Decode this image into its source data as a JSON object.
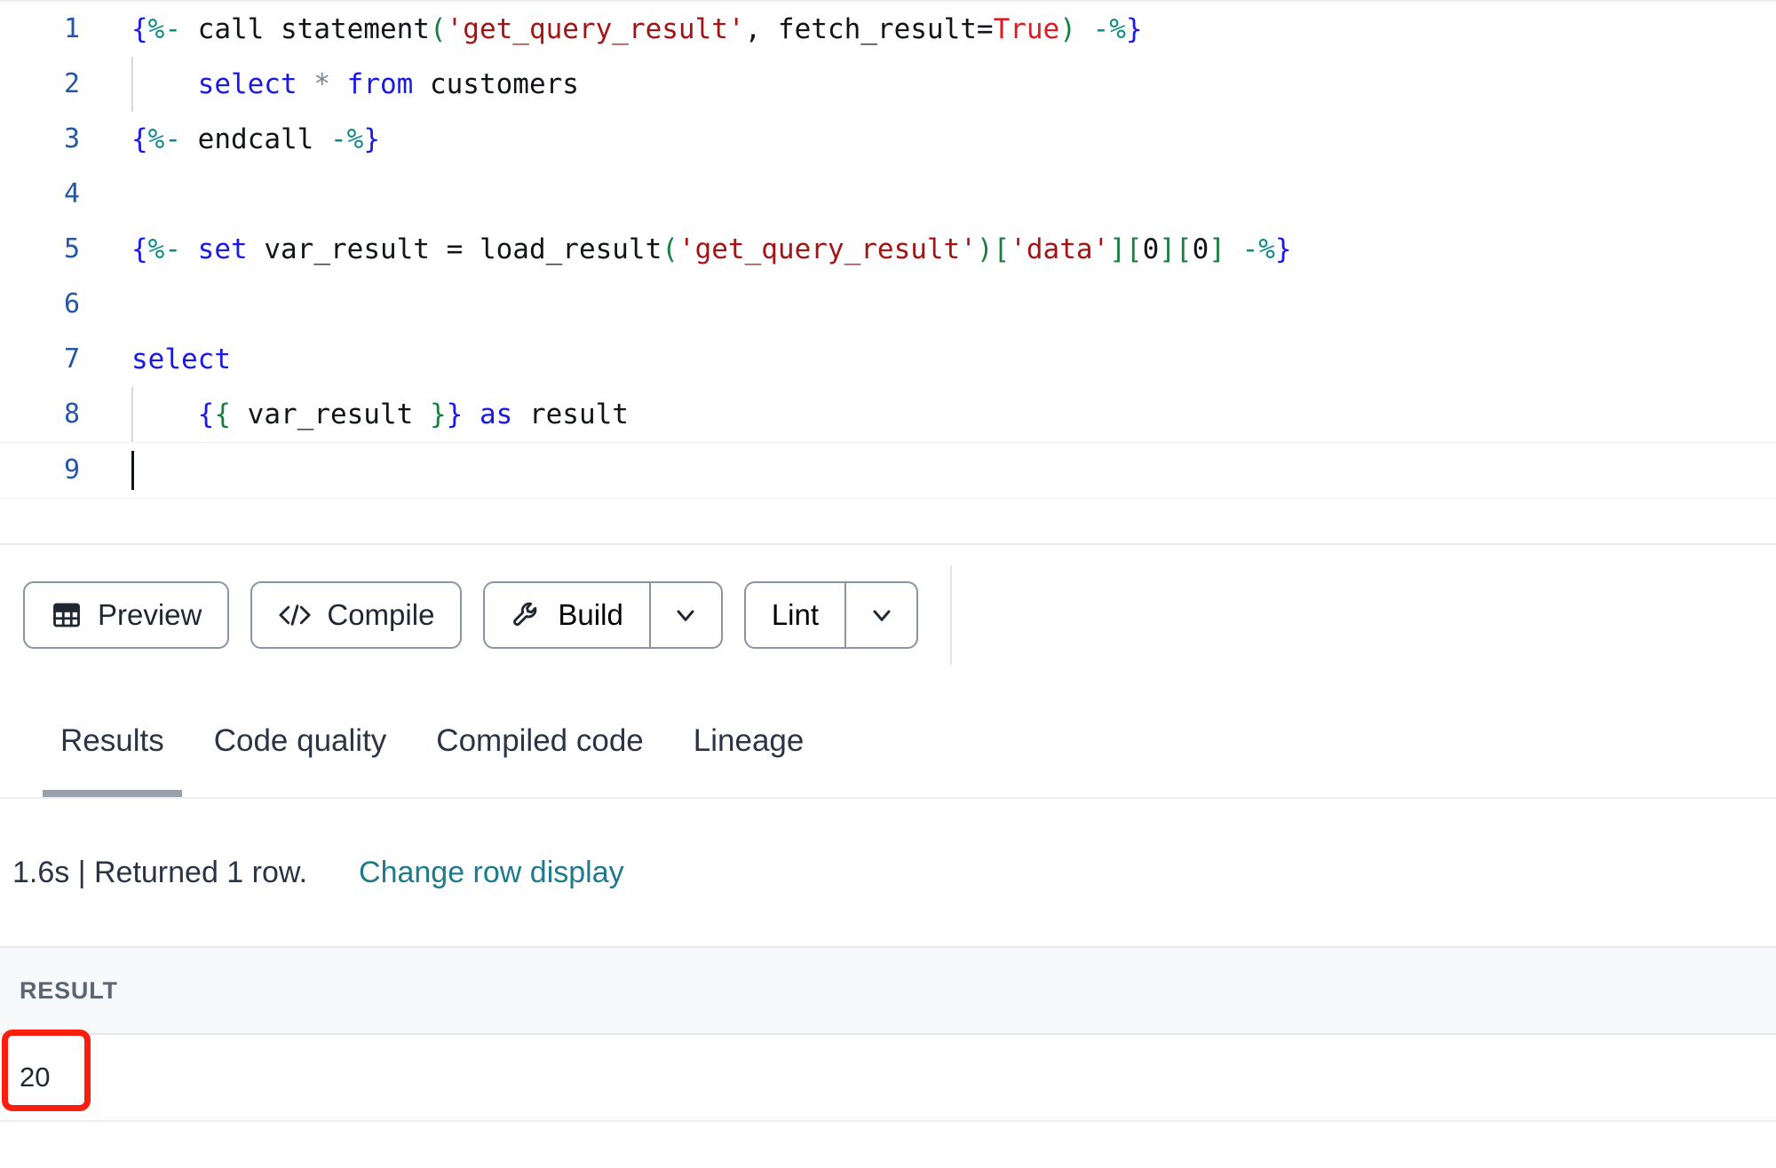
{
  "editor": {
    "lines": [
      {
        "number": "1",
        "indent_guide": false,
        "caret": false,
        "tokens": [
          {
            "text": "{",
            "cls": "t-brace"
          },
          {
            "text": "%- ",
            "cls": "t-pct"
          },
          {
            "text": "call",
            "cls": "t-plain"
          },
          {
            "text": " statement",
            "cls": "t-plain"
          },
          {
            "text": "(",
            "cls": "t-paren"
          },
          {
            "text": "'get_query_result'",
            "cls": "t-str"
          },
          {
            "text": ",",
            "cls": "t-plain"
          },
          {
            "text": " fetch_result=",
            "cls": "t-plain"
          },
          {
            "text": "True",
            "cls": "t-bool"
          },
          {
            "text": ")",
            "cls": "t-paren"
          },
          {
            "text": " -",
            "cls": "t-pct"
          },
          {
            "text": "%",
            "cls": "t-pct"
          },
          {
            "text": "}",
            "cls": "t-brace"
          }
        ]
      },
      {
        "number": "2",
        "indent_guide": true,
        "caret": false,
        "tokens": [
          {
            "text": "    ",
            "cls": "t-plain"
          },
          {
            "text": "select",
            "cls": "t-kw"
          },
          {
            "text": " ",
            "cls": "t-plain"
          },
          {
            "text": "*",
            "cls": "t-star"
          },
          {
            "text": " ",
            "cls": "t-plain"
          },
          {
            "text": "from",
            "cls": "t-kw"
          },
          {
            "text": " customers",
            "cls": "t-plain"
          }
        ]
      },
      {
        "number": "3",
        "indent_guide": false,
        "caret": false,
        "tokens": [
          {
            "text": "{",
            "cls": "t-brace"
          },
          {
            "text": "%- ",
            "cls": "t-pct"
          },
          {
            "text": "endcall",
            "cls": "t-plain"
          },
          {
            "text": " -",
            "cls": "t-pct"
          },
          {
            "text": "%",
            "cls": "t-pct"
          },
          {
            "text": "}",
            "cls": "t-brace"
          }
        ]
      },
      {
        "number": "4",
        "indent_guide": false,
        "caret": false,
        "tokens": []
      },
      {
        "number": "5",
        "indent_guide": false,
        "caret": false,
        "tokens": [
          {
            "text": "{",
            "cls": "t-brace"
          },
          {
            "text": "%- ",
            "cls": "t-pct"
          },
          {
            "text": "set",
            "cls": "t-kw"
          },
          {
            "text": " var_result = load_result",
            "cls": "t-plain"
          },
          {
            "text": "(",
            "cls": "t-paren"
          },
          {
            "text": "'get_query_result'",
            "cls": "t-str"
          },
          {
            "text": ")",
            "cls": "t-paren"
          },
          {
            "text": "[",
            "cls": "t-paren"
          },
          {
            "text": "'data'",
            "cls": "t-str"
          },
          {
            "text": "]",
            "cls": "t-paren"
          },
          {
            "text": "[",
            "cls": "t-paren"
          },
          {
            "text": "0",
            "cls": "t-plain"
          },
          {
            "text": "]",
            "cls": "t-paren"
          },
          {
            "text": "[",
            "cls": "t-paren"
          },
          {
            "text": "0",
            "cls": "t-plain"
          },
          {
            "text": "]",
            "cls": "t-paren"
          },
          {
            "text": " -",
            "cls": "t-pct"
          },
          {
            "text": "%",
            "cls": "t-pct"
          },
          {
            "text": "}",
            "cls": "t-brace"
          }
        ]
      },
      {
        "number": "6",
        "indent_guide": false,
        "caret": false,
        "tokens": []
      },
      {
        "number": "7",
        "indent_guide": false,
        "caret": false,
        "tokens": [
          {
            "text": "select",
            "cls": "t-kw"
          }
        ]
      },
      {
        "number": "8",
        "indent_guide": true,
        "caret": false,
        "tokens": [
          {
            "text": "    ",
            "cls": "t-plain"
          },
          {
            "text": "{",
            "cls": "t-brace"
          },
          {
            "text": "{",
            "cls": "t-inner"
          },
          {
            "text": " var_result ",
            "cls": "t-plain"
          },
          {
            "text": "}",
            "cls": "t-inner"
          },
          {
            "text": "}",
            "cls": "t-brace"
          },
          {
            "text": " ",
            "cls": "t-plain"
          },
          {
            "text": "as",
            "cls": "t-kw"
          },
          {
            "text": " result",
            "cls": "t-plain"
          }
        ]
      },
      {
        "number": "9",
        "indent_guide": false,
        "caret": true,
        "tokens": []
      }
    ]
  },
  "toolbar": {
    "preview_label": "Preview",
    "preview_icon": "table-icon",
    "compile_label": "Compile",
    "compile_icon": "code-brackets-icon",
    "build_label": "Build",
    "build_icon": "wrench-icon",
    "build_caret_icon": "chevron-down-icon",
    "lint_label": "Lint",
    "lint_caret_icon": "chevron-down-icon"
  },
  "tabs": {
    "items": [
      {
        "label": "Results",
        "active": true
      },
      {
        "label": "Code quality",
        "active": false
      },
      {
        "label": "Compiled code",
        "active": false
      },
      {
        "label": "Lineage",
        "active": false
      }
    ]
  },
  "status": {
    "meta": "1.6s | Returned 1 row.",
    "duration": "1.6s",
    "row_summary": "Returned 1 row.",
    "change_row_display_label": "Change row display",
    "link_color": "#1f7a8c"
  },
  "results_table": {
    "columns": [
      "RESULT"
    ],
    "rows": [
      [
        "20"
      ]
    ],
    "highlight": {
      "cell": "20",
      "color": "#fa1e0e"
    }
  }
}
